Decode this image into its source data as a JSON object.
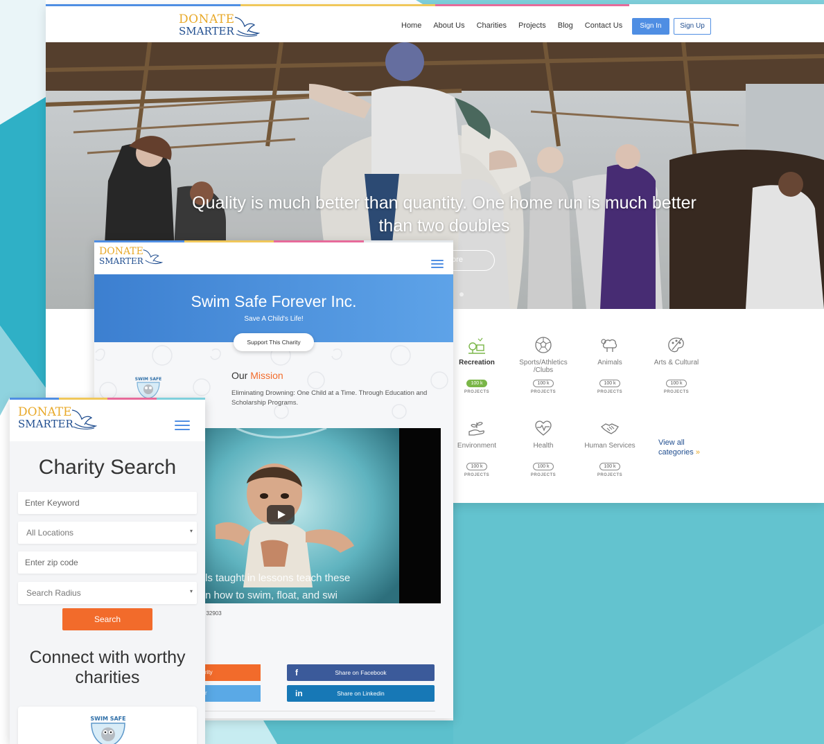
{
  "brand": {
    "line1": "DONATE",
    "line2": "SMARTER",
    "colors": {
      "gold": "#e8a92a",
      "navy": "#1f4d8f",
      "blue": "#4f8ee3",
      "orange": "#f26b2b",
      "teal": "#6ec9d4",
      "green": "#7ab648"
    }
  },
  "desktop": {
    "nav": [
      "Home",
      "About Us",
      "Charities",
      "Projects",
      "Blog",
      "Contact Us"
    ],
    "signin_label": "Sign In",
    "signup_label": "Sign Up",
    "hero_quote": "Quality is much better than quantity. One home run is much better than two doubles",
    "hero_button": "ore",
    "categories": [
      {
        "label": "Recreation",
        "count": "100 k",
        "sub": "PROJECTS",
        "icon": "recreation-icon",
        "active": true
      },
      {
        "label": "Sports/Athletics /Clubs",
        "count": "100 k",
        "sub": "PROJECTS",
        "icon": "soccer-ball-icon",
        "active": false
      },
      {
        "label": "Animals",
        "count": "100 k",
        "sub": "PROJECTS",
        "icon": "sheep-icon",
        "active": false
      },
      {
        "label": "Arts & Cultural",
        "count": "100 k",
        "sub": "PROJECTS",
        "icon": "palette-icon",
        "active": false
      },
      {
        "label": "Environment",
        "count": "100 k",
        "sub": "PROJECTS",
        "icon": "plant-hand-icon",
        "active": false
      },
      {
        "label": "Health",
        "count": "100 k",
        "sub": "PROJECTS",
        "icon": "heart-pulse-icon",
        "active": false
      },
      {
        "label": "Human Services",
        "count": "100 k",
        "sub": "PROJECTS",
        "icon": "handshake-icon",
        "active": false
      }
    ],
    "view_all_line1": "View all",
    "view_all_line2": "categories",
    "view_all_arrow": "»"
  },
  "charity": {
    "name": "Swim Safe Forever Inc.",
    "tagline": "Save A Child's Life!",
    "support_button": "Support This Charity",
    "mission_title": "Our",
    "mission_highlight": "Mission",
    "mission_text": "Eliminating Drowning: One Child at a Time. Through Education and Scholarship Programs.",
    "logo_text": "SWIM SAFE",
    "video_sub1": "ls taught in lessons teach these",
    "video_sub2": "n how to swim, float, and swi",
    "zip_fragment": ", 32903",
    "donate_fragment": "rity",
    "share_fragment": "r",
    "share_facebook": "Share on Facebook",
    "share_linkedin": "Share on Linkedin",
    "icons": {
      "facebook": "f",
      "linkedin": "in"
    }
  },
  "mobile": {
    "title": "Charity Search",
    "keyword_placeholder": "Enter Keyword",
    "location_value": "All Locations",
    "zip_placeholder": "Enter zip code",
    "radius_value": "Search Radius",
    "select_arrow": "▾",
    "search_button": "Search",
    "connect_text": "Connect with worthy charities",
    "card_logo_text": "SWIM SAFE"
  }
}
